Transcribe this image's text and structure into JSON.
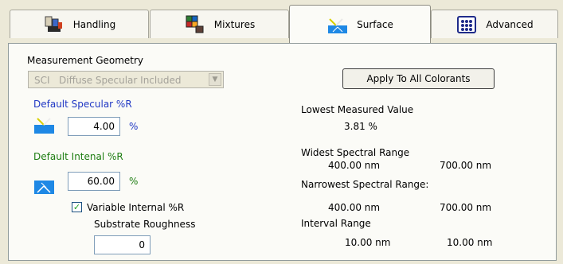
{
  "tabs": [
    {
      "label": "Handling",
      "icon": "handling-icon"
    },
    {
      "label": "Mixtures",
      "icon": "mixtures-icon"
    },
    {
      "label": "Surface",
      "icon": "surface-icon"
    },
    {
      "label": "Advanced",
      "icon": "advanced-icon"
    }
  ],
  "active_tab": "Surface",
  "geometry": {
    "label": "Measurement Geometry",
    "selected_code": "SCI",
    "selected_label": "Diffuse Specular Included"
  },
  "apply_button": "Apply To All Colorants",
  "specular": {
    "label": "Default Specular %R",
    "value": "4.00",
    "unit": "%"
  },
  "internal": {
    "label": "Default Intenal %R",
    "value": "60.00",
    "unit": "%"
  },
  "variable_internal": {
    "label": "Variable Internal %R",
    "checked": true
  },
  "roughness": {
    "label": "Substrate Roughness",
    "value": "0"
  },
  "stats": {
    "lowest_label": "Lowest Measured Value",
    "lowest_value": "3.81 %",
    "widest_label": "Widest Spectral Range",
    "widest_min": "400.00 nm",
    "widest_max": "700.00 nm",
    "narrowest_label": "Narrowest Spectral Range:",
    "narrowest_min": "400.00 nm",
    "narrowest_max": "700.00 nm",
    "interval_label": "Interval Range",
    "interval_min": "10.00 nm",
    "interval_max": "10.00 nm"
  },
  "colors": {
    "label_blue": "#1f37c4",
    "label_green": "#1e7d12",
    "check": "#21a121"
  }
}
